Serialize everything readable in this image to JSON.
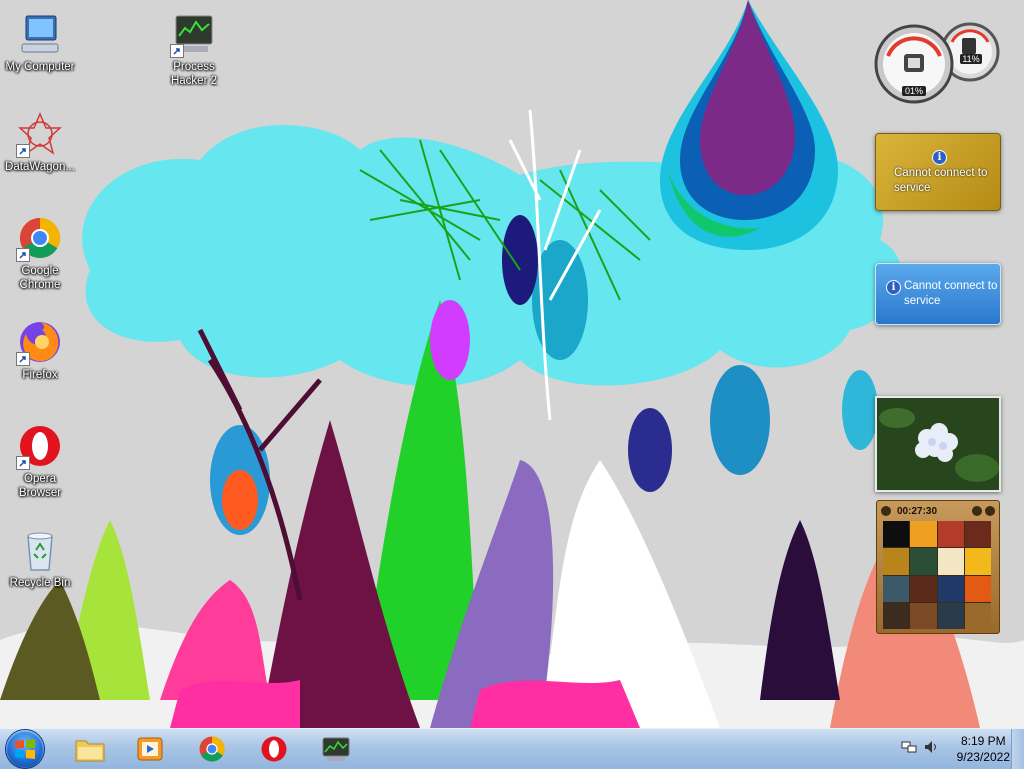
{
  "desktop": {
    "icons": [
      {
        "label": "My Computer"
      },
      {
        "label": "Process Hacker 2"
      },
      {
        "label": "DataWagon..."
      },
      {
        "label": "Google Chrome"
      },
      {
        "label": "Firefox"
      },
      {
        "label": "Opera Browser"
      },
      {
        "label": "Recycle Bin"
      }
    ]
  },
  "gadgets": {
    "cpu_meter": {
      "cpu": "01%",
      "memory": "11%"
    },
    "currency": {
      "message": "Cannot connect to service"
    },
    "weather": {
      "message": "Cannot connect to service"
    },
    "puzzle": {
      "timer": "00:27:30"
    }
  },
  "taskbar": {
    "pinned": [
      "windows-explorer-icon",
      "media-player-icon",
      "chrome-icon",
      "opera-icon",
      "process-hacker-icon"
    ],
    "clock": {
      "time": "8:19 PM",
      "date": "9/23/2022"
    }
  },
  "colors": {
    "taskbar_top": "#cfe0f2",
    "taskbar_bottom": "#93b5de",
    "wallpaper_bg": "#d4d4d4",
    "cloud": "#66e6ef"
  }
}
